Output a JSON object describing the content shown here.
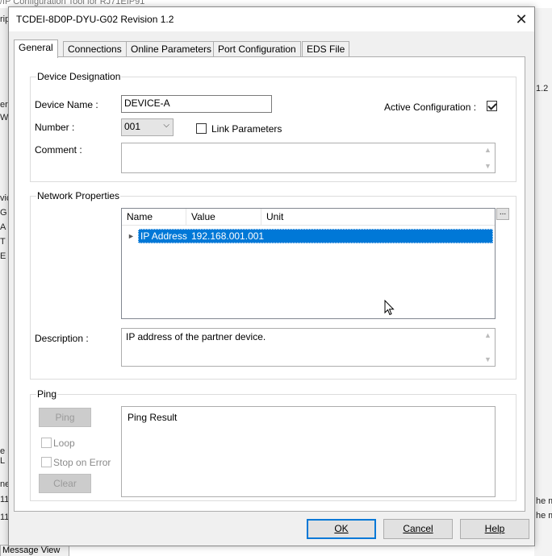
{
  "background": {
    "title_fragment": "/IP Configuration Tool for RJ71EIP91",
    "left_fragments": [
      "rip",
      "er",
      "W",
      "vic",
      "G",
      "A",
      "T",
      "E",
      "e L",
      "ne",
      "11:",
      "11:"
    ],
    "right_fragments": [
      "1.2",
      "he m",
      "he m"
    ],
    "bottom_tab": "Message View"
  },
  "dialog": {
    "title": "TCDEI-8D0P-DYU-G02 Revision 1.2",
    "close_glyph": "✕"
  },
  "tabs": [
    {
      "label": "General",
      "active": true
    },
    {
      "label": "Connections",
      "active": false
    },
    {
      "label": "Online Parameters",
      "active": false
    },
    {
      "label": "Port Configuration",
      "active": false
    },
    {
      "label": "EDS File",
      "active": false
    }
  ],
  "device_designation": {
    "group_label": "Device Designation",
    "device_name_label": "Device Name :",
    "device_name_value": "DEVICE-A",
    "active_config_label": "Active Configuration :",
    "active_config_checked": true,
    "number_label": "Number :",
    "number_value": "001",
    "link_params_label": "Link Parameters",
    "link_params_checked": false,
    "comment_label": "Comment :",
    "comment_value": ""
  },
  "network_properties": {
    "group_label": "Network Properties",
    "columns": [
      "Name",
      "Value",
      "Unit"
    ],
    "rows": [
      {
        "name": "IP Address",
        "value": "192.168.001.001",
        "unit": ""
      }
    ],
    "ellipsis_label": "...",
    "description_label": "Description :",
    "description_value": "IP address of the partner device."
  },
  "ping": {
    "group_label": "Ping",
    "ping_button": "Ping",
    "loop_label": "Loop",
    "stop_on_error_label": "Stop on Error",
    "clear_button": "Clear",
    "result_label": "Ping Result"
  },
  "footer": {
    "ok": "OK",
    "cancel": "Cancel",
    "help": "Help"
  },
  "colors": {
    "selection": "#0078d7",
    "default_button_border": "#0078d7"
  }
}
